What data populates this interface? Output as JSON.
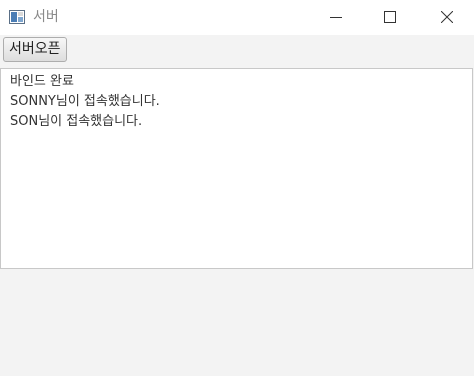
{
  "window": {
    "title": "서버"
  },
  "toolbar": {
    "open_button_label": "서버오픈"
  },
  "log": {
    "lines": [
      "바인드 완료",
      "SONNY님이 접속했습니다.",
      "SON님이 접속했습니다."
    ]
  },
  "icons": {
    "app": "java-app-icon",
    "minimize": "minimize-icon",
    "maximize": "maximize-icon",
    "close": "close-icon"
  }
}
